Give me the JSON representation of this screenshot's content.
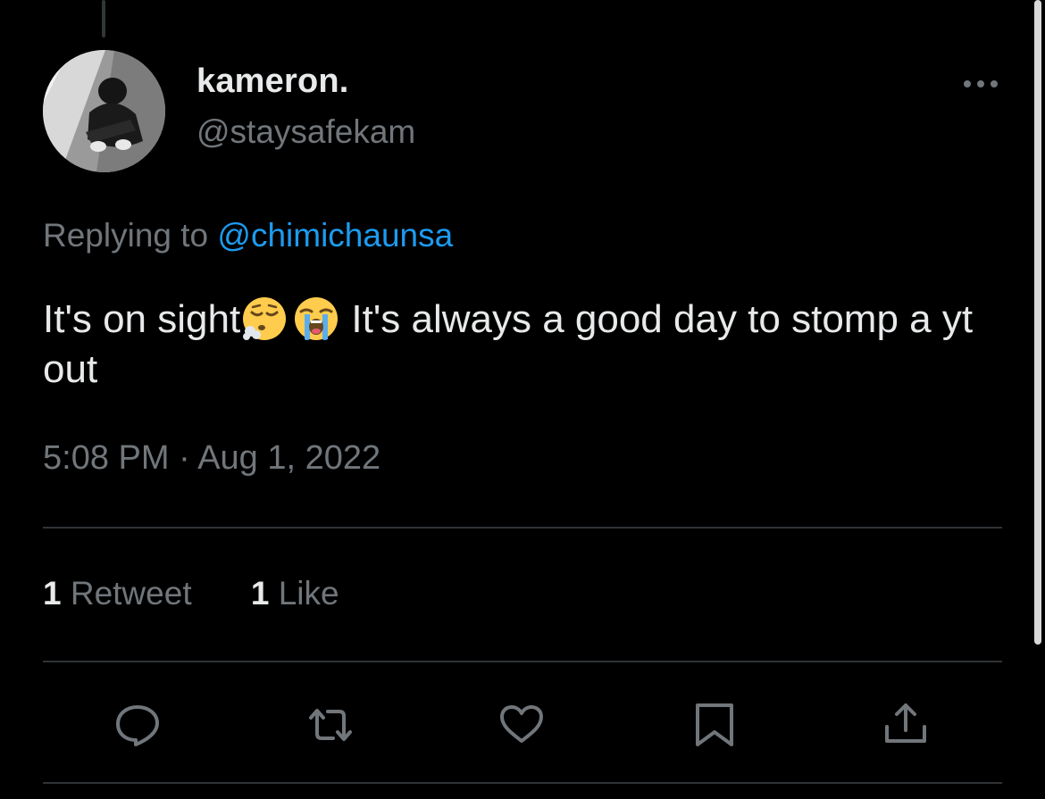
{
  "author": {
    "display_name": "kameron.",
    "handle": "@staysafekam"
  },
  "reply": {
    "prefix": "Replying to",
    "mention": "@chimichaunsa"
  },
  "tweet": {
    "text_before_emoji": "It's on sight",
    "emoji_1": "face-exhaling",
    "emoji_2": "loudly-crying-face",
    "text_after_emoji": " It's always a good day to stomp a yt out",
    "timestamp": "5:08 PM · Aug 1, 2022"
  },
  "stats": {
    "retweets_count": "1",
    "retweets_label": "Retweet",
    "likes_count": "1",
    "likes_label": "Like"
  },
  "actions": [
    "reply-icon",
    "retweet-icon",
    "like-icon",
    "bookmark-icon",
    "share-icon"
  ],
  "colors": {
    "background": "#000000",
    "text_primary": "#e7e9ea",
    "text_secondary": "#71767b",
    "accent": "#1d9bf0",
    "divider": "#2f3336"
  }
}
